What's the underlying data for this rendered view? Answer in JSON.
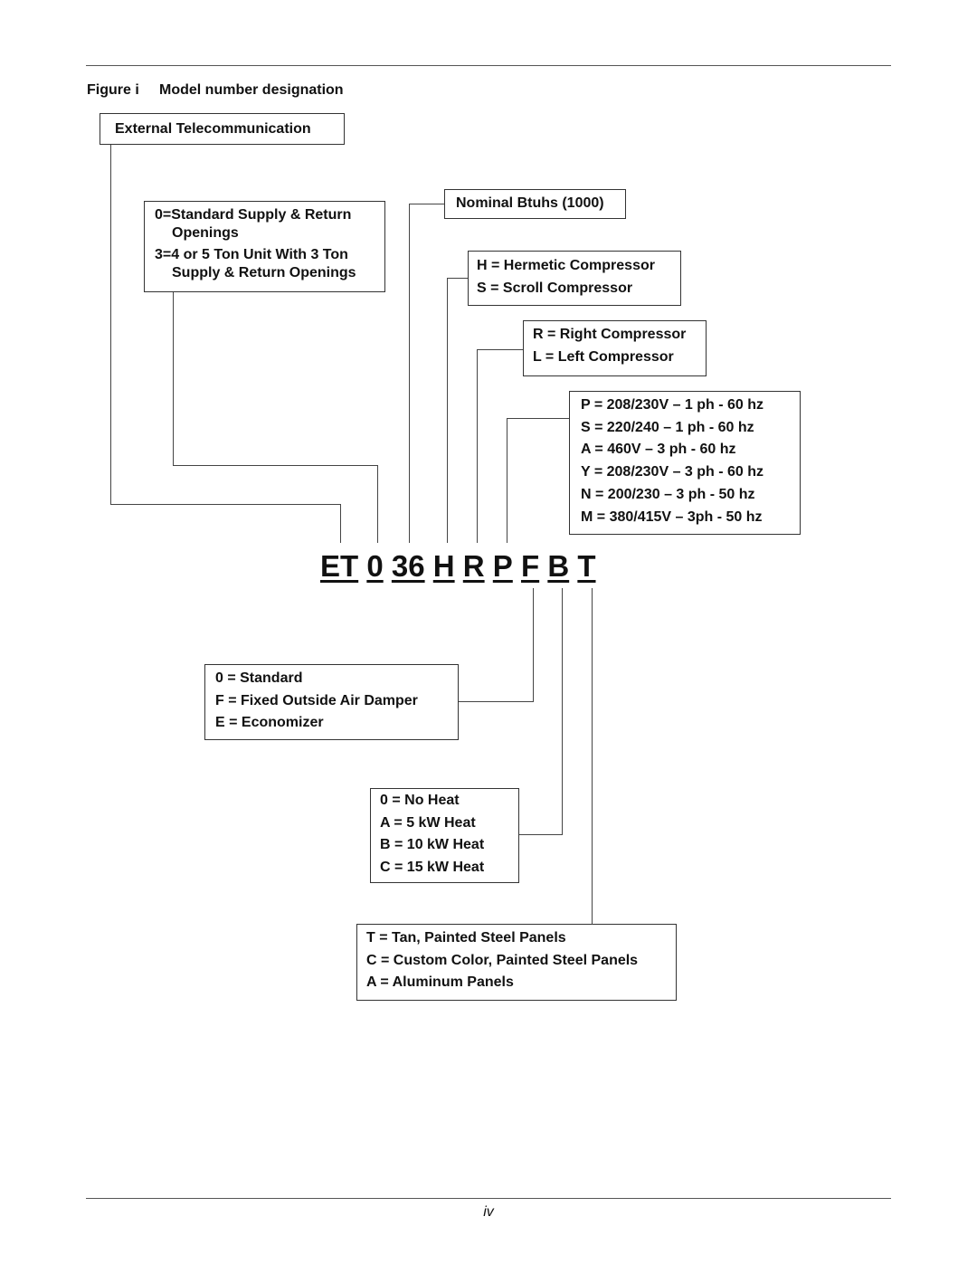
{
  "figure": {
    "label": "Figure i",
    "title": "Model number designation"
  },
  "model_code": {
    "segments": [
      "ET",
      "0",
      "36",
      "H",
      "R",
      "P",
      "F",
      "B",
      "T"
    ]
  },
  "boxes": {
    "telecom": {
      "lines": [
        "External Telecommunication"
      ]
    },
    "openings": {
      "lines": [
        "0=Standard Supply & Return",
        "Openings",
        "3=4 or 5 Ton Unit With 3 Ton",
        "Supply & Return Openings"
      ]
    },
    "btuhs": {
      "lines": [
        "Nominal Btuhs (1000)"
      ]
    },
    "compressor_type": {
      "lines": [
        "H = Hermetic Compressor",
        "S = Scroll Compressor"
      ]
    },
    "compressor_side": {
      "lines": [
        "R = Right Compressor",
        "L = Left Compressor"
      ]
    },
    "voltage": {
      "lines": [
        "P = 208/230V – 1 ph - 60 hz",
        "S = 220/240 – 1 ph - 60 hz",
        "A = 460V – 3 ph - 60 hz",
        "Y = 208/230V – 3 ph - 60 hz",
        "N = 200/230 – 3 ph - 50 hz",
        "M = 380/415V – 3ph - 50 hz"
      ]
    },
    "outside_air": {
      "lines": [
        "0 = Standard",
        "F = Fixed Outside Air Damper",
        "E = Economizer"
      ]
    },
    "heat": {
      "lines": [
        "0 = No Heat",
        "A = 5 kW Heat",
        "B = 10 kW Heat",
        "C = 15 kW Heat"
      ]
    },
    "panels": {
      "lines": [
        "T = Tan, Painted Steel Panels",
        "C = Custom Color, Painted Steel Panels",
        "A = Aluminum Panels"
      ]
    }
  },
  "page_number": "iv"
}
